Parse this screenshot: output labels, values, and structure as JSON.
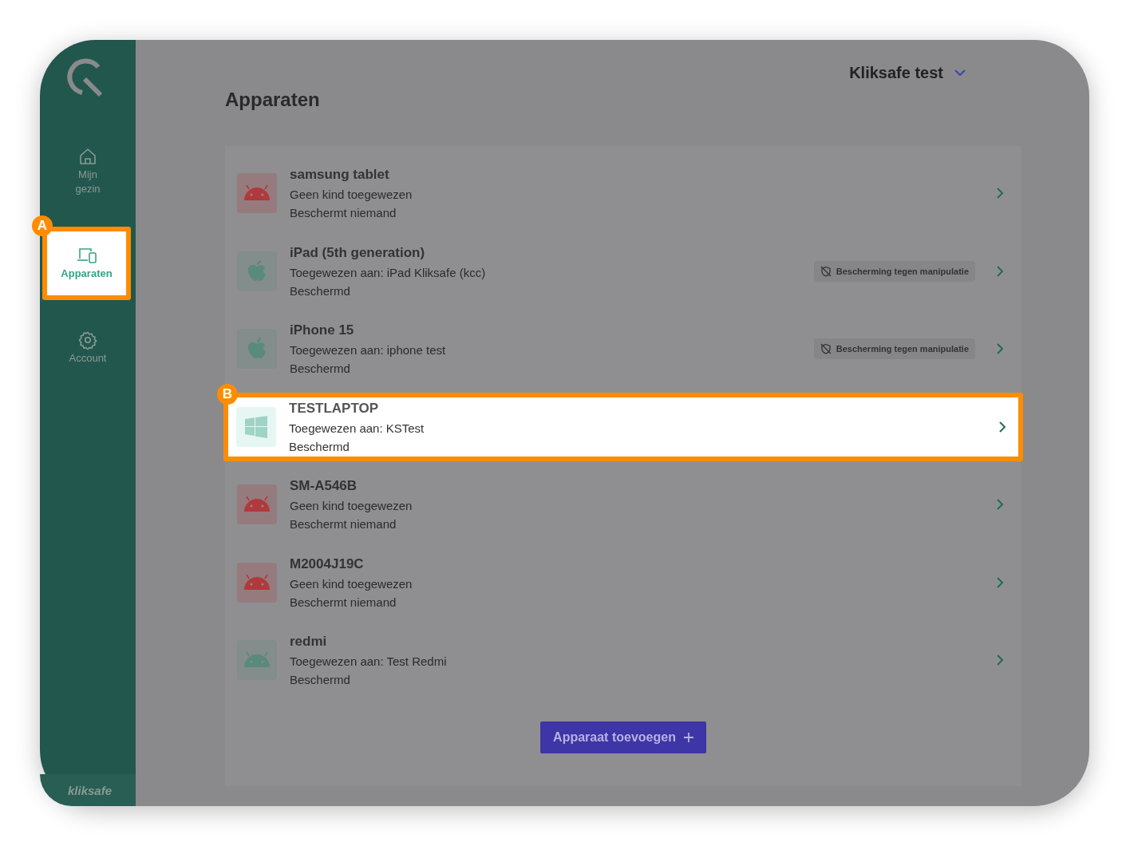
{
  "sidebar": {
    "nav": [
      {
        "label": "Mijn gezin",
        "kind": "home",
        "selected": false
      },
      {
        "label": "Apparaten",
        "kind": "devices",
        "selected": true,
        "callout": "A"
      },
      {
        "label": "Account",
        "kind": "gear",
        "selected": false
      }
    ],
    "footer": "kliksafe"
  },
  "account_selector": {
    "label": "Kliksafe test"
  },
  "title": "Apparaten",
  "devices": [
    {
      "name": "samsung tablet",
      "kind": "android",
      "color": "#b0393c",
      "assignment": "Geen kind toegewezen",
      "status": "Beschermt niemand",
      "highlighted": false
    },
    {
      "name": "iPad (5th generation)",
      "kind": "apple",
      "color": "#5a8a7c",
      "assignment": "Toegewezen aan: iPad Kliksafe (kcc)",
      "status": "Beschermd",
      "badge": "Bescherming tegen manipulatie",
      "highlighted": false
    },
    {
      "name": "iPhone 15",
      "kind": "apple",
      "color": "#5a8a7c",
      "assignment": "Toegewezen aan: iphone test",
      "status": "Beschermd",
      "badge": "Bescherming tegen manipulatie",
      "highlighted": false
    },
    {
      "name": "TESTLAPTOP",
      "kind": "windows",
      "color": "#9fd3c5",
      "assignment": "Toegewezen aan: KSTest",
      "status": "Beschermd",
      "highlighted": true,
      "callout": "B"
    },
    {
      "name": "SM-A546B",
      "kind": "android",
      "color": "#b0393c",
      "assignment": "Geen kind toegewezen",
      "status": "Beschermt niemand",
      "highlighted": false
    },
    {
      "name": "M2004J19C",
      "kind": "android",
      "color": "#b0393c",
      "assignment": "Geen kind toegewezen",
      "status": "Beschermt niemand",
      "highlighted": false
    },
    {
      "name": "redmi",
      "kind": "android",
      "color": "#5a8a7c",
      "assignment": "Toegewezen aan: Test Redmi",
      "status": "Beschermd",
      "highlighted": false
    }
  ],
  "add_button": {
    "label": "Apparaat toevoegen"
  }
}
